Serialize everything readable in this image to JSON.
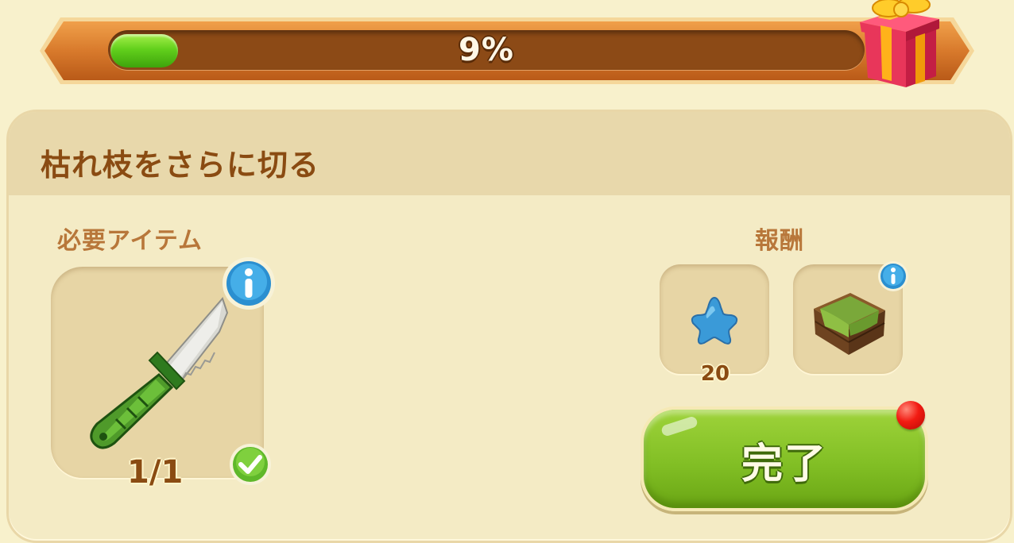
{
  "progress": {
    "percent_label": "9%",
    "fraction": 0.09
  },
  "task": {
    "title": "枯れ枝をさらに切る"
  },
  "required": {
    "label": "必要アイテム",
    "item_icon": "knife-icon",
    "count": "1/1",
    "status_icon": "checkmark-icon",
    "info_icon": "info-icon"
  },
  "rewards": {
    "label": "報酬",
    "items": [
      {
        "icon": "blue-star-icon",
        "amount": "20"
      },
      {
        "icon": "moss-crate-icon",
        "info_icon": "info-icon"
      }
    ]
  },
  "actions": {
    "complete_label": "完了"
  },
  "colors": {
    "banner": "#d4782a",
    "panel": "#f4ebc5",
    "header": "#e8d8ab",
    "title_text": "#8a4b12",
    "button_green": "#82bf25",
    "notification_red": "#f21b12"
  }
}
